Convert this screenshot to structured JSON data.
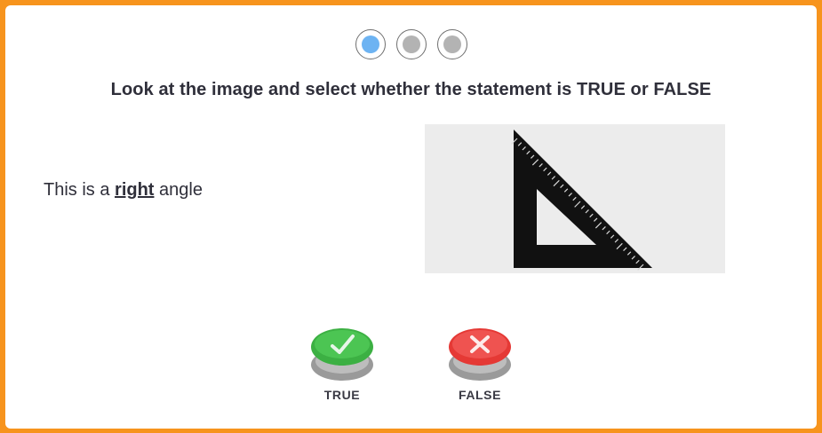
{
  "progress": {
    "steps": 3,
    "current": 1
  },
  "question": {
    "instruction": "Look at the image and select whether the statement is TRUE or FALSE",
    "statement_prefix": "This is a ",
    "statement_key": "right",
    "statement_suffix": " angle",
    "image_icon": "set-square-ruler-icon"
  },
  "answers": {
    "true_label": "TRUE",
    "false_label": "FALSE"
  },
  "colors": {
    "frame": "#f7941d",
    "active_dot": "#6db3f2",
    "inactive_dot": "#b3b3b3",
    "true_button": "#3cb043",
    "false_button": "#e53935"
  }
}
